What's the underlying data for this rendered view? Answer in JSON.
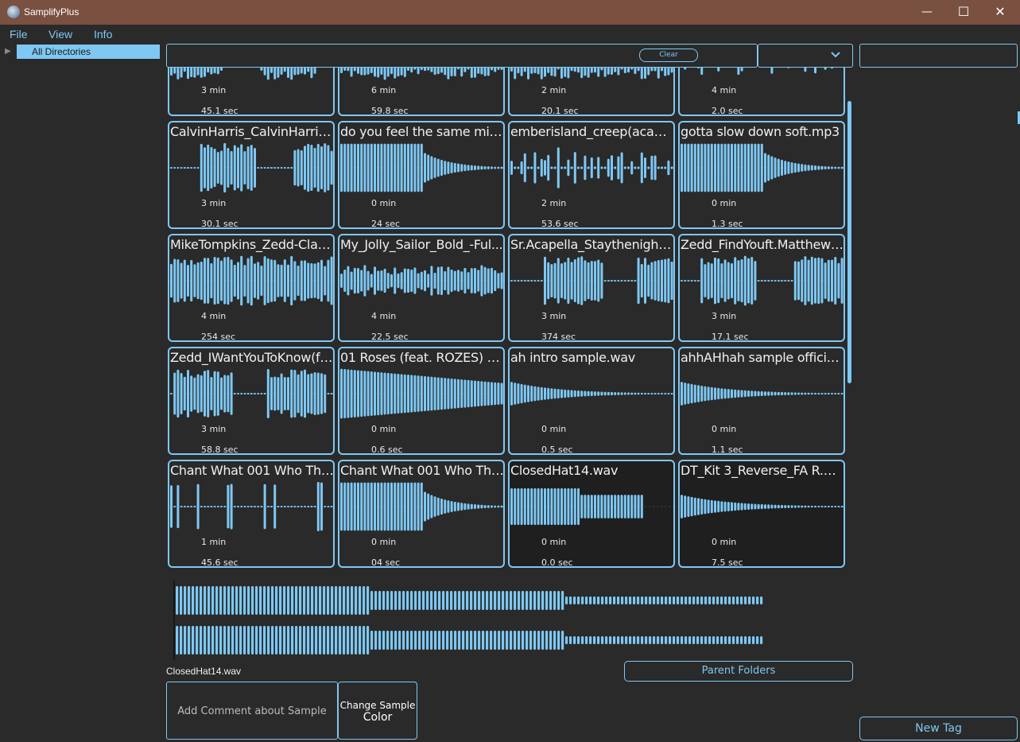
{
  "window": {
    "title": "SamplifyPlus",
    "minimize": "—",
    "maximize": "☐",
    "close": "✕"
  },
  "menu": [
    "File",
    "View",
    "Info"
  ],
  "tree": {
    "arrow": "▶",
    "root": "All Directories"
  },
  "search": {
    "clear_label": "Clear",
    "value": ""
  },
  "colors": {
    "accent": "#7ec8f3",
    "background": "#2a2a2a",
    "titlebar": "#7a5040"
  },
  "tiles": [
    {
      "name": "",
      "min": "3 min",
      "sec": "45.1 sec",
      "wave": "loud-gaps"
    },
    {
      "name": "",
      "min": "6 min",
      "sec": "59.8 sec",
      "wave": "dense"
    },
    {
      "name": "",
      "min": "2 min",
      "sec": "20.1 sec",
      "wave": "dense"
    },
    {
      "name": "",
      "min": "4 min",
      "sec": "2.0 sec",
      "wave": "sparse"
    },
    {
      "name": "CalvinHarris_CalvinHarrisFl...",
      "min": "3 min",
      "sec": "30.1 sec",
      "wave": "loud-gaps"
    },
    {
      "name": "do you feel the same mid....",
      "min": "0 min",
      "sec": "24 sec",
      "wave": "decay-long"
    },
    {
      "name": "emberisland_creep(acapell...",
      "min": "2 min",
      "sec": "53.6 sec",
      "wave": "sparse"
    },
    {
      "name": "gotta slow down soft.mp3",
      "min": "0 min",
      "sec": "1.3 sec",
      "wave": "decay-long"
    },
    {
      "name": "MikeTompkins_Zedd-Clarit...",
      "min": "4 min",
      "sec": "254 sec",
      "wave": "dense"
    },
    {
      "name": "My_Jolly_Sailor_Bold_-Ful...",
      "min": "4 min",
      "sec": "22.5 sec",
      "wave": "medium"
    },
    {
      "name": "Sr.Acapella_Staythenight(...",
      "min": "3 min",
      "sec": "374 sec",
      "wave": "loud-gaps"
    },
    {
      "name": "Zedd_FindYouft.MatthewK...",
      "min": "3 min",
      "sec": "17.1 sec",
      "wave": "loud-gaps"
    },
    {
      "name": "Zedd_IWantYouToKnow(fea...",
      "min": "3 min",
      "sec": "58.8 sec",
      "wave": "loud-gaps"
    },
    {
      "name": "01 Roses (feat. ROZES) - P...",
      "min": "0 min",
      "sec": "0.6 sec",
      "wave": "decay-full"
    },
    {
      "name": "ah intro sample.wav",
      "min": "0 min",
      "sec": "0.5 sec",
      "wave": "decay-short"
    },
    {
      "name": "ahhAHhah sample official....",
      "min": "0 min",
      "sec": "1.1 sec",
      "wave": "decay-short"
    },
    {
      "name": "Chant What 001 Who Tha ...",
      "min": "1 min",
      "sec": "45.6 sec",
      "wave": "sparse-gaps"
    },
    {
      "name": "Chant What 001 Who Tha ...",
      "min": "0 min",
      "sec": "04 sec",
      "wave": "decay-long"
    },
    {
      "name": "ClosedHat14.wav",
      "min": "0 min",
      "sec": "0.0 sec",
      "wave": "steps",
      "selected": true
    },
    {
      "name": "DT_Kit 3_Reverse_FA R.wav",
      "min": "0 min",
      "sec": "7.5 sec",
      "wave": "decay-short",
      "selected": true
    }
  ],
  "selected_sample": "ClosedHat14.wav",
  "buttons": {
    "parent_folders": "Parent Folders",
    "add_comment": "Add Comment about Sample",
    "change_color_line1": "Change Sample",
    "change_color_line2": "Color",
    "new_tag": "New Tag"
  }
}
